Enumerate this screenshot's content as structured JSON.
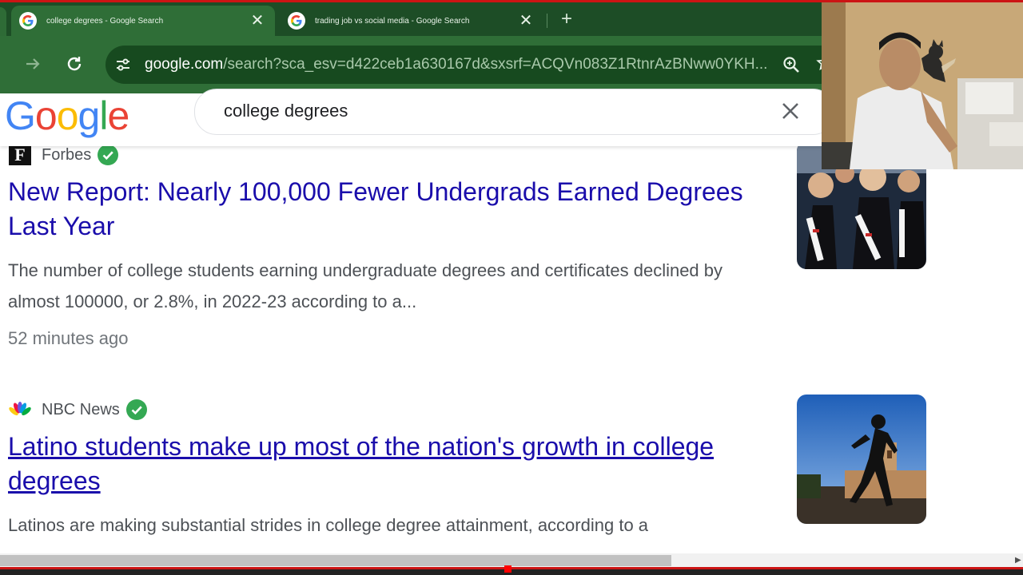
{
  "browser": {
    "tabs": [
      {
        "title": "college degrees - Google Search",
        "active": true
      },
      {
        "title": "trading job vs social media - Google Search",
        "active": false
      }
    ],
    "new_tab_symbol": "+",
    "close_symbol": "✕",
    "url_host": "google.com",
    "url_path": "/search?sca_esv=d422ceb1a630167d&sxsrf=ACQVn083Z1RtnrAzBNww0YKH..."
  },
  "google": {
    "logo_letters": [
      "G",
      "o",
      "o",
      "g",
      "l",
      "e"
    ],
    "logo_colors": [
      "#4285f4",
      "#ea4335",
      "#fbbc05",
      "#4285f4",
      "#34a853",
      "#ea4335"
    ],
    "search_query": "college degrees"
  },
  "results": [
    {
      "source": "Forbes",
      "title": "New Report: Nearly 100,000 Fewer Undergrads Earned Degrees Last Year",
      "snippet": "The number of college students earning undergraduate degrees and certificates declined by almost 100000, or 2.8%, in 2022-23 according to a...",
      "time": "52 minutes ago"
    },
    {
      "source": "NBC News",
      "title": "Latino students make up most of the nation's growth in college degrees",
      "snippet": "Latinos are making substantial strides in college degree attainment, according to a"
    }
  ],
  "colors": {
    "link": "#1a0dab",
    "verified": "#34a853",
    "tab_bar": "#1d4d26",
    "toolbar": "#2f6e37"
  }
}
